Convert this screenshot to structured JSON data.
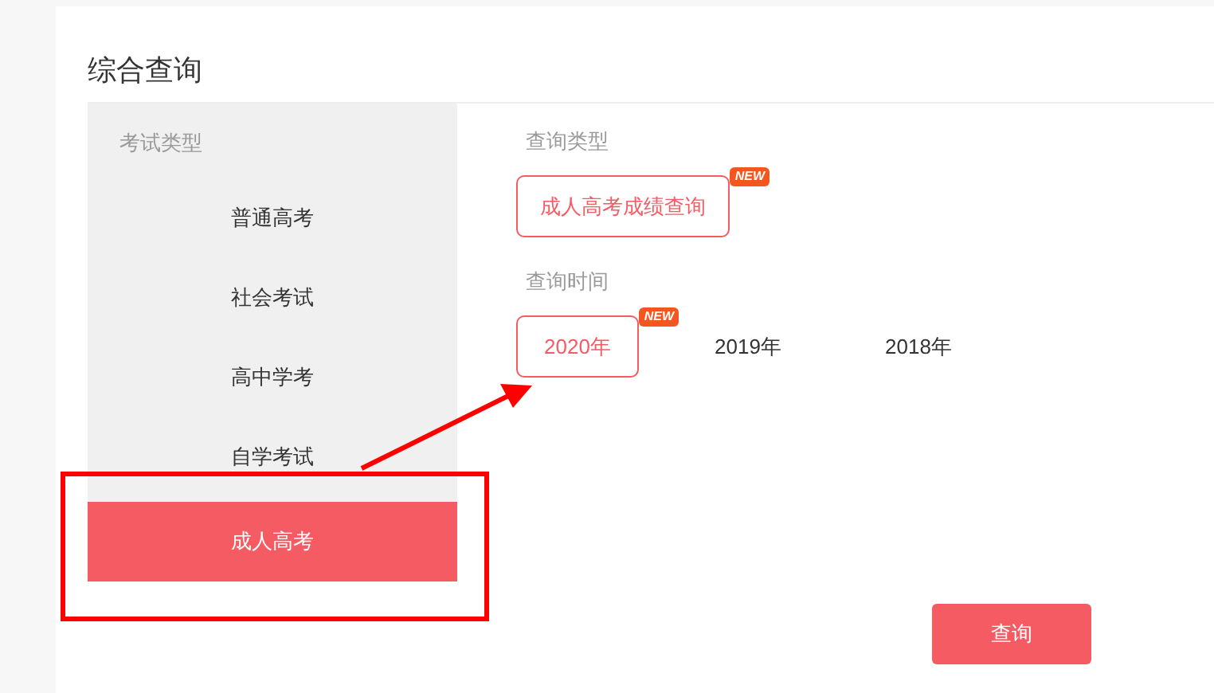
{
  "title": "综合查询",
  "exam_types": {
    "heading": "考试类型",
    "items": [
      {
        "label": "普通高考",
        "selected": false
      },
      {
        "label": "社会考试",
        "selected": false
      },
      {
        "label": "高中学考",
        "selected": false
      },
      {
        "label": "自学考试",
        "selected": false
      },
      {
        "label": "成人高考",
        "selected": true
      }
    ]
  },
  "query_type": {
    "heading": "查询类型",
    "options": [
      {
        "label": "成人高考成绩查询",
        "selected": true,
        "badge": "NEW"
      }
    ]
  },
  "query_time": {
    "heading": "查询时间",
    "options": [
      {
        "label": "2020年",
        "selected": true,
        "badge": "NEW"
      },
      {
        "label": "2019年",
        "selected": false
      },
      {
        "label": "2018年",
        "selected": false
      }
    ]
  },
  "submit": "查询"
}
